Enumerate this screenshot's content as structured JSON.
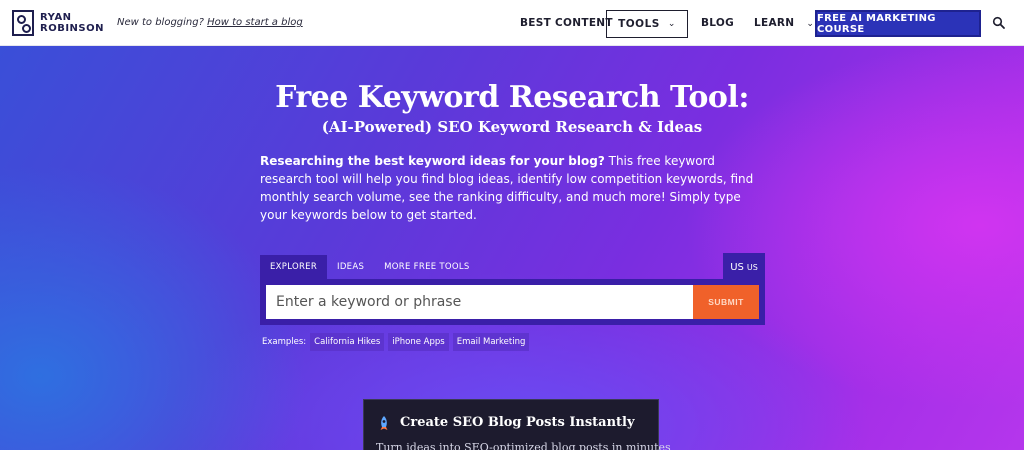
{
  "header": {
    "logo_line1": "RYAN",
    "logo_line2": "ROBINSON",
    "tagline_prefix": "New to blogging?",
    "tagline_link": "How to start a blog",
    "nav": {
      "best_content": "BEST CONTENT",
      "tools": "TOOLS",
      "blog": "BLOG",
      "learn": "LEARN",
      "cta": "FREE AI MARKETING COURSE"
    }
  },
  "hero": {
    "title": "Free Keyword Research Tool:",
    "subtitle": "(AI-Powered) SEO Keyword Research & Ideas",
    "desc_bold": "Researching the best keyword ideas for your blog?",
    "desc_rest": " This free keyword research tool will help you find blog ideas, identify low competition keywords, find monthly search volume, see the ranking difficulty, and much more! Simply type your keywords below to get started."
  },
  "search": {
    "tabs": [
      "EXPLORER",
      "IDEAS",
      "MORE FREE TOOLS"
    ],
    "active_tab": "EXPLORER",
    "country_code": "US",
    "country_label": "US",
    "placeholder": "Enter a keyword or phrase",
    "value": "",
    "submit_label": "SUBMIT",
    "examples_label": "Examples:",
    "examples": [
      "California Hikes",
      "iPhone Apps",
      "Email Marketing"
    ]
  },
  "card": {
    "title": "Create SEO Blog Posts Instantly",
    "text": "Turn ideas into SEO-optimized blog posts in minutes"
  },
  "colors": {
    "accent": "#2b33b8",
    "submit": "#f0612a",
    "widget": "#3a1fa8",
    "card_bg": "#1d1b2e"
  },
  "icons": [
    "logo-mark-icon",
    "chevron-down-icon",
    "search-icon",
    "rocket-icon"
  ]
}
